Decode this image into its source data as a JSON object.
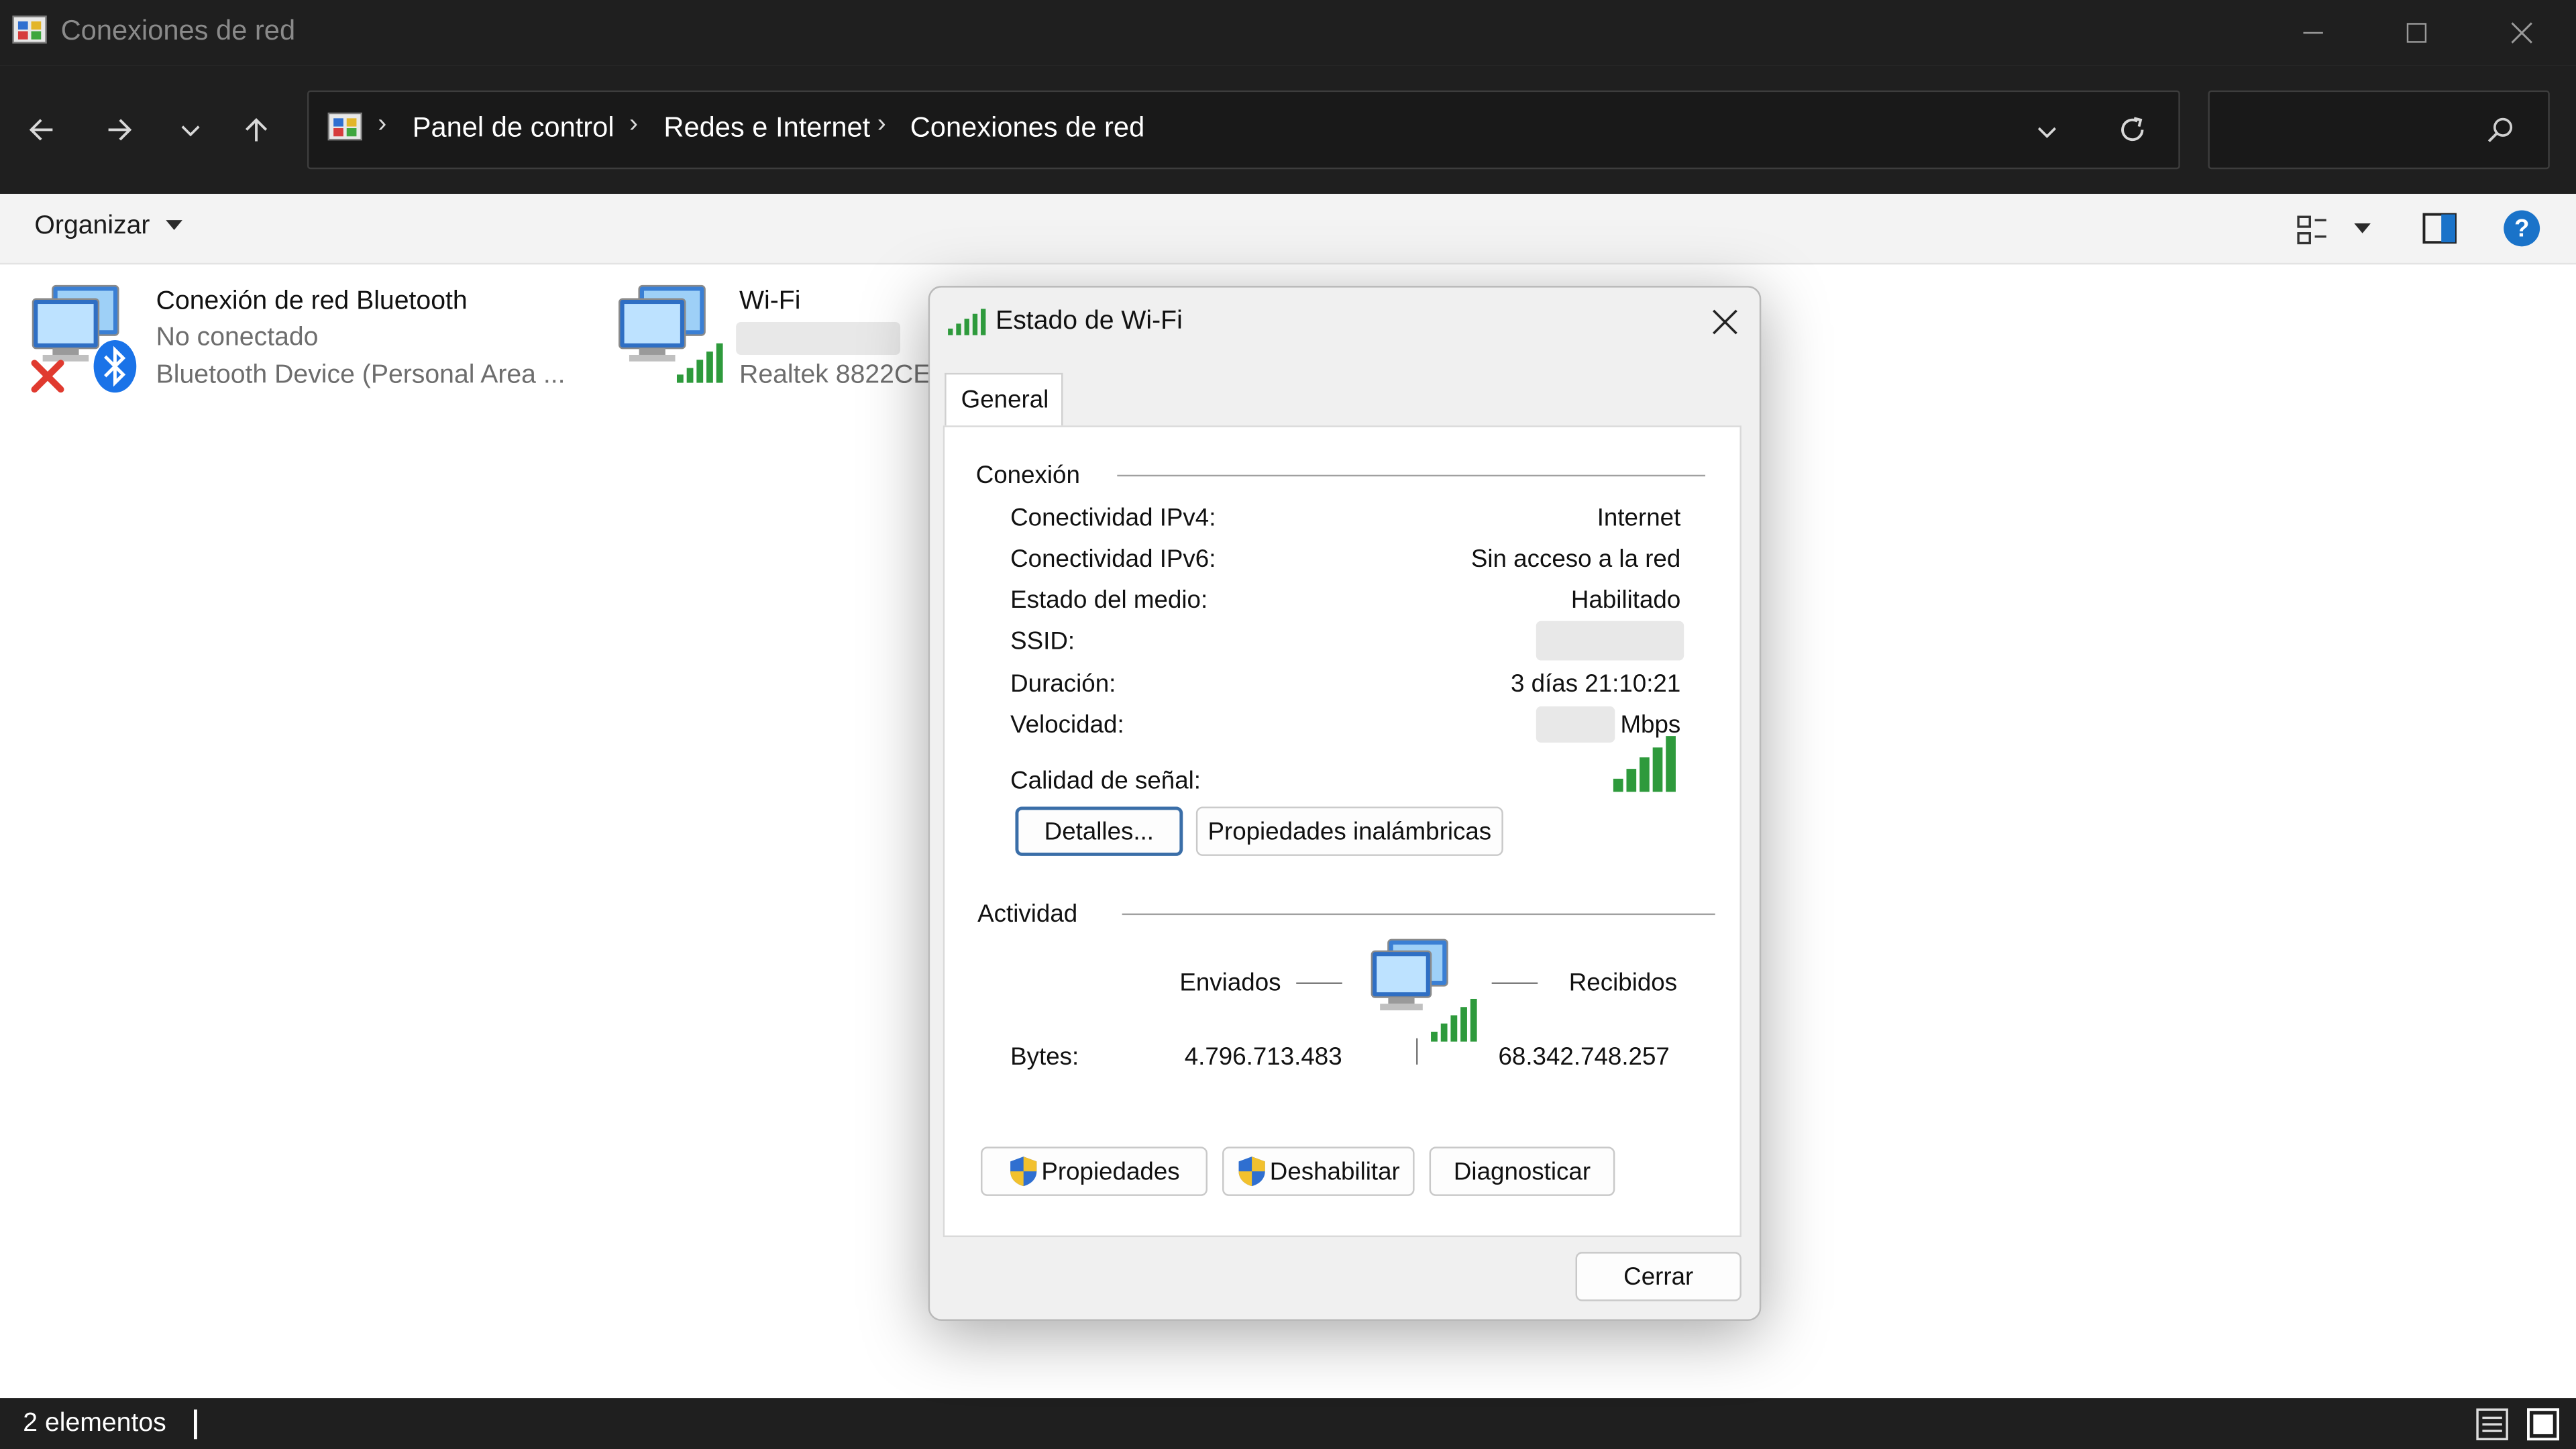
{
  "window": {
    "title": "Conexiones de red"
  },
  "address_bar": {
    "breadcrumbs": [
      "Panel de control",
      "Redes e Internet",
      "Conexiones de red"
    ]
  },
  "command_bar": {
    "organize_label": "Organizar"
  },
  "items": [
    {
      "name": "Conexión de red Bluetooth",
      "status": "No conectado",
      "device": "Bluetooth Device (Personal Area ..."
    },
    {
      "name": "Wi-Fi",
      "status": "",
      "device": "Realtek 8822CE"
    }
  ],
  "status_bar": {
    "count_text": "2 elementos"
  },
  "dialog": {
    "title": "Estado de Wi-Fi",
    "tab": "General",
    "connection": {
      "heading": "Conexión",
      "rows": [
        {
          "label": "Conectividad IPv4:",
          "value": "Internet"
        },
        {
          "label": "Conectividad IPv6:",
          "value": "Sin acceso a la red"
        },
        {
          "label": "Estado del medio:",
          "value": "Habilitado"
        },
        {
          "label": "SSID:",
          "value": ""
        },
        {
          "label": "Duración:",
          "value": "3 días 21:10:21"
        },
        {
          "label": "Velocidad:",
          "value": "Mbps"
        }
      ],
      "signal_label": "Calidad de señal:",
      "signal_bars": 5,
      "details_button": "Detalles...",
      "wireless_props_button": "Propiedades inalámbricas"
    },
    "activity": {
      "heading": "Actividad",
      "sent_label": "Enviados",
      "received_label": "Recibidos",
      "bytes_label": "Bytes:",
      "bytes_sent": "4.796.713.483",
      "bytes_received": "68.342.748.257"
    },
    "buttons": {
      "properties": "Propiedades",
      "disable": "Deshabilitar",
      "diagnose": "Diagnosticar",
      "close": "Cerrar"
    }
  },
  "colors": {
    "chrome_dark": "#1f1f1f",
    "signal_green": "#2e9a3c",
    "accent_blue": "#1a73c9",
    "error_red": "#e03a2f"
  },
  "icons": [
    "control-panel-icon",
    "back-icon",
    "forward-icon",
    "recent-icon",
    "up-icon",
    "refresh-icon",
    "search-icon",
    "view-icon",
    "preview-pane-icon",
    "help-icon",
    "bluetooth-icon",
    "wifi-signal-icon",
    "network-computer-icon",
    "shield-icon",
    "close-icon"
  ]
}
